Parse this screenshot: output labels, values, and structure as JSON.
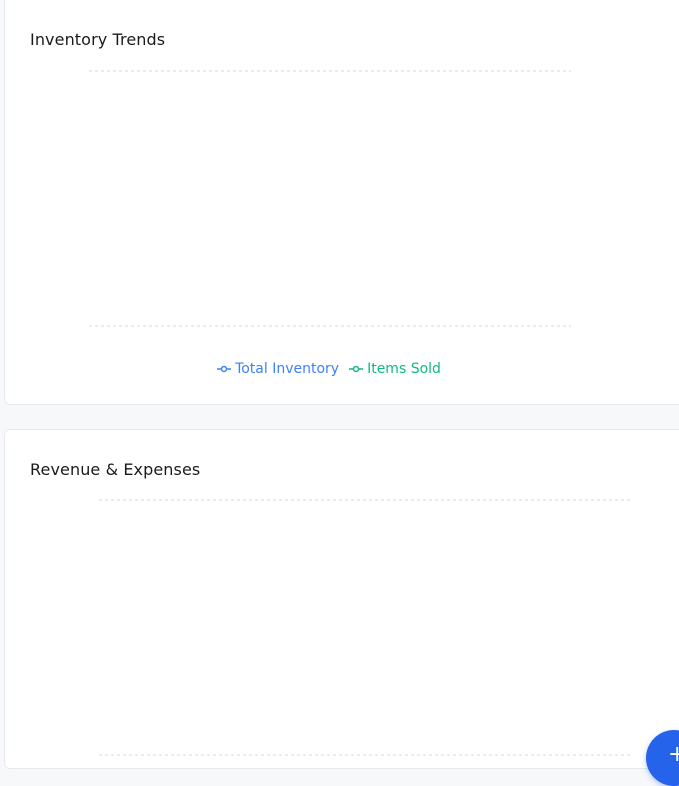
{
  "colors": {
    "total_inventory": "#3b82f6",
    "items_sold": "#10b981",
    "grid": "#dcdfe4",
    "fab": "#2563eb"
  },
  "inventory_card": {
    "title": "Inventory Trends",
    "legend": [
      {
        "label": "Total Inventory",
        "color": "#3b82f6"
      },
      {
        "label": "Items Sold",
        "color": "#10b981"
      }
    ]
  },
  "revenue_card": {
    "title": "Revenue & Expenses"
  },
  "fab": {
    "icon": "plus-icon",
    "glyph": "+"
  }
}
